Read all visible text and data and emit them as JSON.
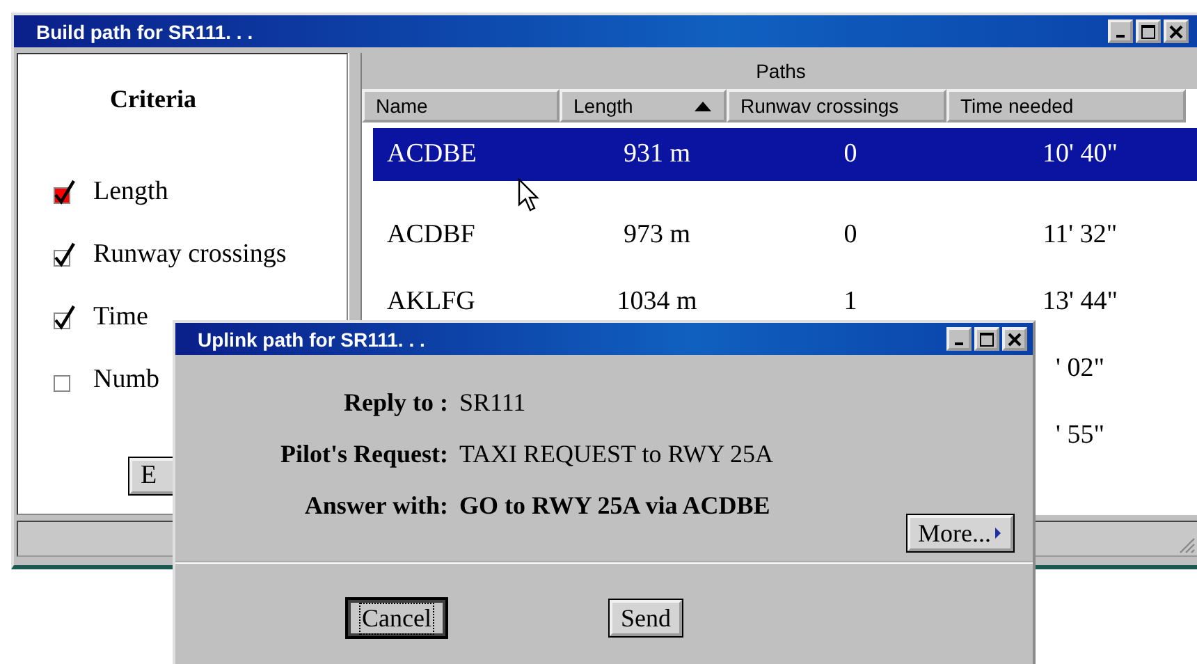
{
  "main_window": {
    "title": "Build path for SR111. . .",
    "criteria": {
      "heading": "Criteria",
      "items": [
        {
          "label": "Length",
          "checked": true,
          "highlighted": true
        },
        {
          "label": "Runway crossings",
          "checked": true,
          "highlighted": false
        },
        {
          "label": "Time",
          "checked": true,
          "highlighted": false
        },
        {
          "label": "Numb",
          "checked": false,
          "highlighted": false
        }
      ]
    },
    "edit_button": "E",
    "paths": {
      "title": "Paths",
      "columns": [
        {
          "label": "Name",
          "sorted": false
        },
        {
          "label": "Length",
          "sorted": true
        },
        {
          "label": "Runwav crossings",
          "sorted": false
        },
        {
          "label": "Time needed",
          "sorted": false
        }
      ],
      "rows": [
        {
          "name": "ACDBE",
          "length": "931 m",
          "crossings": "0",
          "time": "10' 40\"",
          "selected": true
        },
        {
          "name": "ACDBF",
          "length": "973 m",
          "crossings": "0",
          "time": "11' 32\"",
          "selected": false
        },
        {
          "name": "AKLFG",
          "length": "1034 m",
          "crossings": "1",
          "time": "13' 44\"",
          "selected": false
        },
        {
          "time": "' 02\"",
          "selected": false
        },
        {
          "time": "' 55\"",
          "selected": false
        }
      ]
    }
  },
  "dialog": {
    "title": "Uplink path for SR111. . .",
    "fields": [
      {
        "label": "Reply to :",
        "value": "SR111",
        "kind": "plain"
      },
      {
        "label": "Pilot's Request:",
        "value": "TAXI REQUEST to RWY 25A",
        "kind": "plain"
      },
      {
        "label": "Answer with:",
        "value": "GO to RWY 25A via ACDBE",
        "kind": "bold"
      }
    ],
    "more_button": "More...",
    "buttons": [
      {
        "label": "Cancel",
        "focused": true
      },
      {
        "label": "Send",
        "focused": false
      }
    ]
  }
}
